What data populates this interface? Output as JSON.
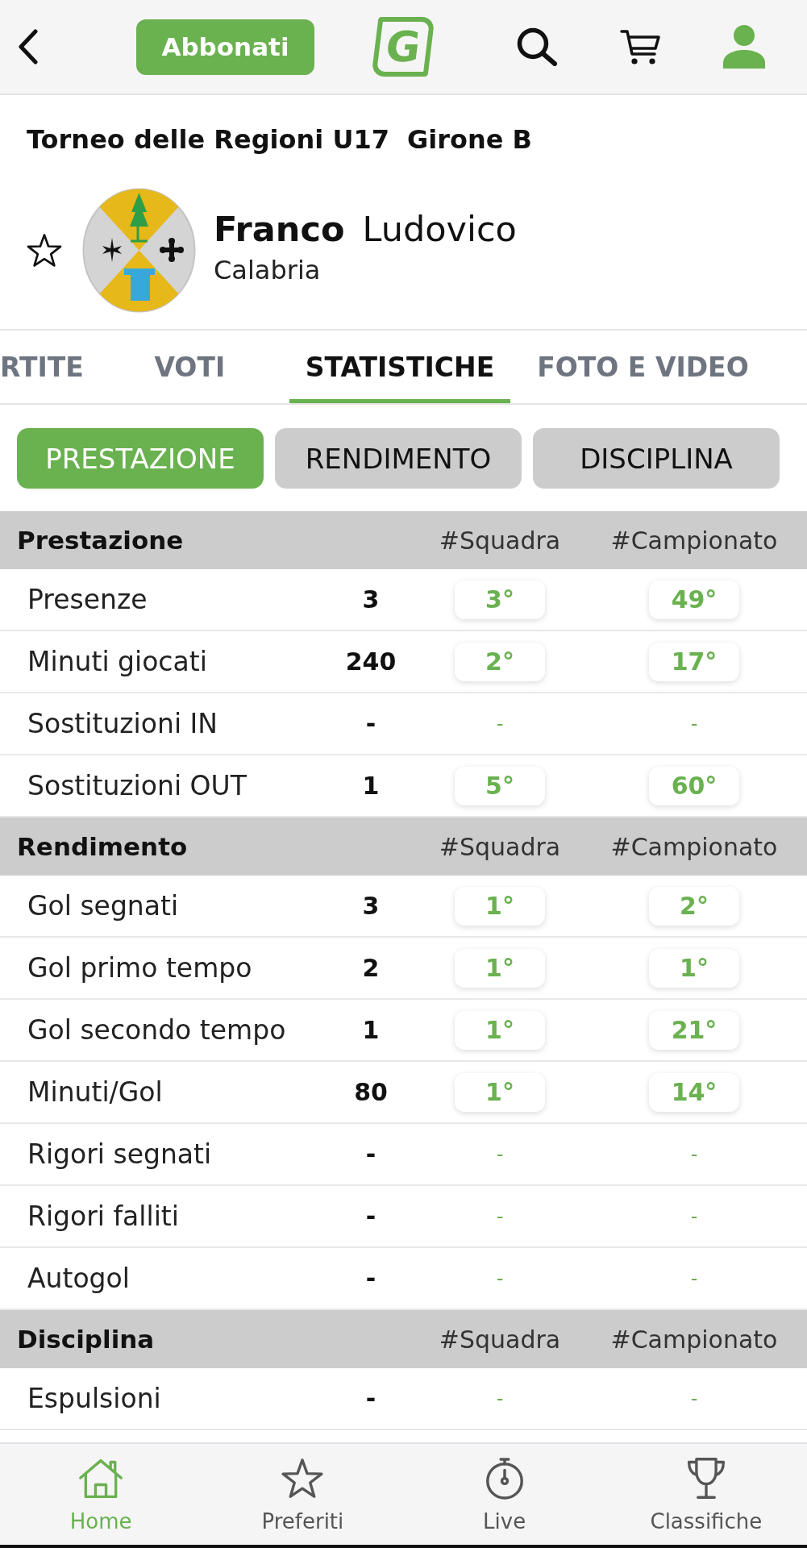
{
  "top_bar": {
    "subscribe_button": "Abbonati",
    "logo": "G"
  },
  "competition": {
    "name": "Torneo delle Regioni U17",
    "group": "Girone B"
  },
  "player": {
    "surname": "Franco",
    "name": "Ludovico",
    "team": "Calabria",
    "favorite": false
  },
  "tabs": [
    {
      "label": "RTITE",
      "selected": false
    },
    {
      "label": "VOTI",
      "selected": false
    },
    {
      "label": "STATISTICHE",
      "selected": true
    },
    {
      "label": "FOTO E VIDEO",
      "selected": false
    }
  ],
  "filters": [
    {
      "label": "PRESTAZIONE",
      "selected": true
    },
    {
      "label": "RENDIMENTO",
      "selected": false
    },
    {
      "label": "DISCIPLINA",
      "selected": false
    }
  ],
  "sections": [
    {
      "title": "Prestazione",
      "column_team": "#Squadra",
      "column_league": "#Campionato",
      "rows": [
        {
          "label": "Presenze",
          "value": "3",
          "ranked": true,
          "team_rank": "3°",
          "league_rank": "49°"
        },
        {
          "label": "Minuti giocati",
          "value": "240",
          "ranked": true,
          "team_rank": "2°",
          "league_rank": "17°"
        },
        {
          "label": "Sostituzioni IN",
          "value": "-",
          "ranked": false,
          "team_rank": "-",
          "league_rank": "-"
        },
        {
          "label": "Sostituzioni OUT",
          "value": "1",
          "ranked": true,
          "team_rank": "5°",
          "league_rank": "60°"
        }
      ]
    },
    {
      "title": "Rendimento",
      "column_team": "#Squadra",
      "column_league": "#Campionato",
      "rows": [
        {
          "label": "Gol segnati",
          "value": "3",
          "ranked": true,
          "team_rank": "1°",
          "league_rank": "2°"
        },
        {
          "label": "Gol primo tempo",
          "value": "2",
          "ranked": true,
          "team_rank": "1°",
          "league_rank": "1°"
        },
        {
          "label": "Gol secondo tempo",
          "value": "1",
          "ranked": true,
          "team_rank": "1°",
          "league_rank": "21°"
        },
        {
          "label": "Minuti/Gol",
          "value": "80",
          "ranked": true,
          "team_rank": "1°",
          "league_rank": "14°"
        },
        {
          "label": "Rigori segnati",
          "value": "-",
          "ranked": false,
          "team_rank": "-",
          "league_rank": "-"
        },
        {
          "label": "Rigori falliti",
          "value": "-",
          "ranked": false,
          "team_rank": "-",
          "league_rank": "-"
        },
        {
          "label": "Autogol",
          "value": "-",
          "ranked": false,
          "team_rank": "-",
          "league_rank": "-"
        }
      ]
    },
    {
      "title": "Disciplina",
      "column_team": "#Squadra",
      "column_league": "#Campionato",
      "rows": [
        {
          "label": "Espulsioni",
          "value": "-",
          "ranked": false,
          "team_rank": "-",
          "league_rank": "-"
        }
      ]
    }
  ],
  "bottom_nav": [
    {
      "label": "Home",
      "selected": true
    },
    {
      "label": "Preferiti",
      "selected": false
    },
    {
      "label": "Live",
      "selected": false
    },
    {
      "label": "Classifiche",
      "selected": false
    }
  ]
}
